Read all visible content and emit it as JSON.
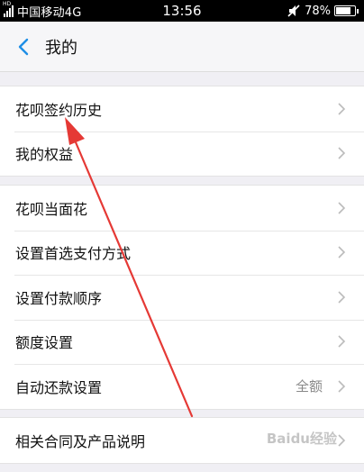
{
  "status_bar": {
    "network_badge": "HD",
    "carrier": "中国移动4G",
    "time": "13:56",
    "battery": "78%",
    "battery_level": 0.78,
    "icons": [
      "signal-icon",
      "mute-icon",
      "battery-icon"
    ]
  },
  "nav": {
    "title": "我的",
    "back_icon": "chevron-left-icon",
    "accent": "#1e8ee6"
  },
  "groups": [
    {
      "items": [
        {
          "label": "花呗签约历史"
        },
        {
          "label": "我的权益"
        }
      ]
    },
    {
      "items": [
        {
          "label": "花呗当面花"
        },
        {
          "label": "设置首选支付方式"
        },
        {
          "label": "设置付款顺序"
        },
        {
          "label": "额度设置"
        },
        {
          "label": "自动还款设置",
          "value": "全额"
        }
      ]
    },
    {
      "items": [
        {
          "label": "相关合同及产品说明"
        }
      ]
    }
  ],
  "watermark": "Baidu经验",
  "colors": {
    "background": "#f0eff4",
    "chevron": "#bbbbbb",
    "annotation_arrow": "#e53935"
  }
}
